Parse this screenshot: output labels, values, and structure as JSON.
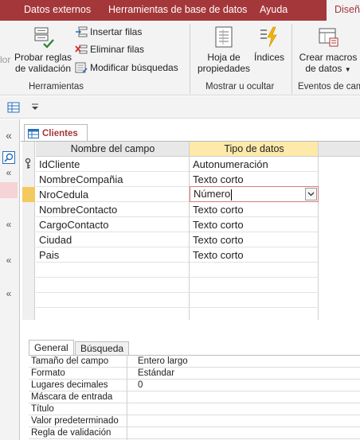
{
  "ribbon_tabs": [
    "Datos externos",
    "Herramientas de base de datos",
    "Ayuda",
    "Diseño"
  ],
  "ribbon": {
    "clipped_left_text": "lor",
    "probar_reglas": [
      "Probar reglas",
      "de validación"
    ],
    "insertar_filas": "Insertar filas",
    "eliminar_filas": "Eliminar filas",
    "modificar_busquedas": "Modificar búsquedas",
    "hoja_propiedades": [
      "Hoja de",
      "propiedades"
    ],
    "indices": "Índices",
    "crear_macros": [
      "Crear macros",
      "de datos"
    ],
    "groups": [
      "Herramientas",
      "Mostrar u ocultar",
      "Eventos de cam"
    ]
  },
  "document": {
    "tab_label": "Clientes",
    "columns": [
      "Nombre del campo",
      "Tipo de datos"
    ],
    "rows": [
      {
        "name": "IdCliente",
        "type": "Autonumeración",
        "key": true
      },
      {
        "name": "NombreCompañia",
        "type": "Texto corto"
      },
      {
        "name": "NroCedula",
        "type": "Número",
        "current": true
      },
      {
        "name": "NombreContacto",
        "type": "Texto corto"
      },
      {
        "name": "CargoContacto",
        "type": "Texto corto"
      },
      {
        "name": "Ciudad",
        "type": "Texto corto"
      },
      {
        "name": "Pais",
        "type": "Texto corto"
      }
    ]
  },
  "properties": {
    "tabs": [
      "General",
      "Búsqueda"
    ],
    "rows": [
      {
        "name": "Tamaño del campo",
        "value": "Entero largo"
      },
      {
        "name": "Formato",
        "value": "Estándar"
      },
      {
        "name": "Lugares decimales",
        "value": "0"
      },
      {
        "name": "Máscara de entrada",
        "value": ""
      },
      {
        "name": "Título",
        "value": ""
      },
      {
        "name": "Valor predeterminado",
        "value": ""
      },
      {
        "name": "Regla de validación",
        "value": ""
      }
    ]
  },
  "colors": {
    "accent": "#a4373a",
    "header_selected": "#fde9a9",
    "row_current": "#f4c95d"
  }
}
